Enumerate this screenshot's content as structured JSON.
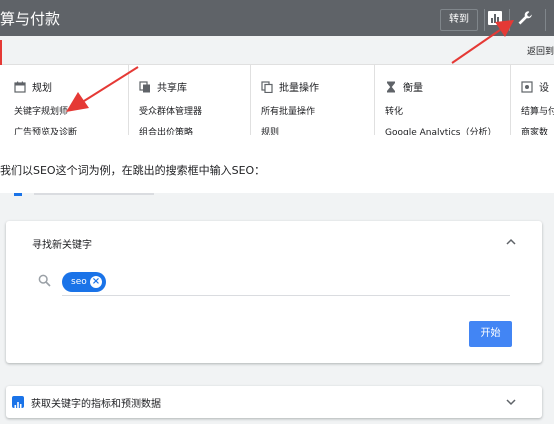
{
  "header": {
    "title": "算与付款",
    "goto_label": "转到",
    "chart_icon": "bar-chart-icon",
    "tools_icon": "wrench-icon",
    "bg_color": "#5f6368"
  },
  "subbar": {
    "back_label": "返回到"
  },
  "menu": {
    "columns": [
      {
        "heading": "规划",
        "icon": "calendar-icon",
        "items": [
          "关键字规划师",
          "广告预览及诊断"
        ]
      },
      {
        "heading": "共享库",
        "icon": "library-icon",
        "items": [
          "受众群体管理器",
          "组合出价策略"
        ]
      },
      {
        "heading": "批量操作",
        "icon": "copy-icon",
        "items": [
          "所有批量操作",
          "规则"
        ]
      },
      {
        "heading": "衡量",
        "icon": "hourglass-icon",
        "items": [
          "转化",
          "Google Analytics（分析）"
        ]
      },
      {
        "heading": "设",
        "icon": "settings-icon",
        "items": [
          "结算与付",
          "商家数"
        ]
      }
    ]
  },
  "caption": "我们以SEO这个词为例，在跳出的搜索框中输入SEO：",
  "search_card": {
    "title": "寻找新关键字",
    "chip_label": "seo",
    "start_label": "开始"
  },
  "metrics_card": {
    "title": "获取关键字的指标和预测数据"
  },
  "colors": {
    "accent": "#1a73e8",
    "button": "#4285f4",
    "annotation_red": "#e53935"
  }
}
